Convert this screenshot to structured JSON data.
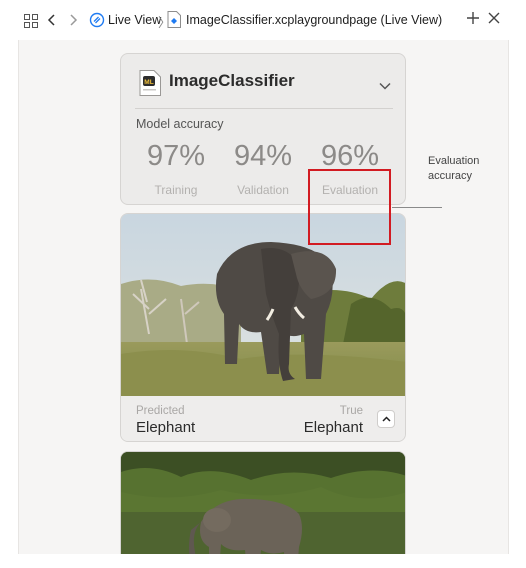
{
  "toolbar": {
    "breadcrumb_live_view": "Live View",
    "breadcrumb_separator": "〉",
    "breadcrumb_page": "ImageClassifier.xcplaygroundpage (Live View)"
  },
  "model_card": {
    "icon_text": "ML",
    "model_name": "ImageClassifier",
    "accuracy_label": "Model accuracy",
    "metrics": [
      {
        "value": "97%",
        "label": "Training"
      },
      {
        "value": "94%",
        "label": "Validation"
      },
      {
        "value": "96%",
        "label": "Evaluation"
      }
    ]
  },
  "callout": {
    "text": "Evaluation accuracy"
  },
  "prediction_card": {
    "predicted_label": "Predicted",
    "predicted_value": "Elephant",
    "true_label": "True",
    "true_value": "Elephant"
  },
  "icons": [
    "grid-icon",
    "back-icon",
    "forward-icon",
    "live-view-icon",
    "playground-page-icon",
    "add-icon",
    "close-icon",
    "chevron-down-icon",
    "chevron-up-icon",
    "ml-model-icon"
  ],
  "colors": {
    "highlight": "#d21b22",
    "canvas_bg": "#f6f5f4",
    "card_bg": "#ecebea",
    "accent_blue": "#1f7bf2"
  }
}
